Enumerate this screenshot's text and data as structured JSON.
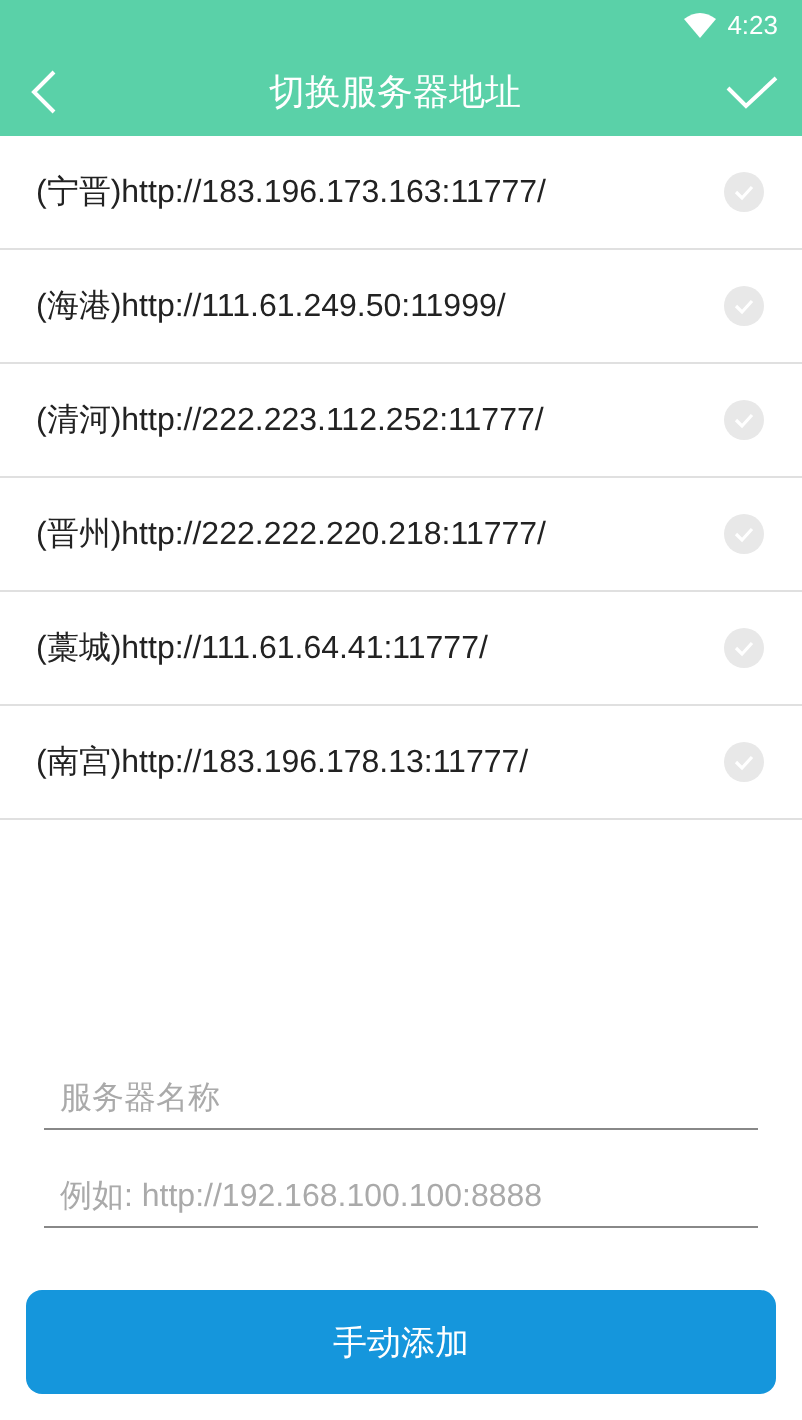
{
  "status_bar": {
    "time": "4:23"
  },
  "app_bar": {
    "title": "切换服务器地址"
  },
  "servers": [
    {
      "label": "(宁晋)http://183.196.173.163:11777/",
      "selected": false
    },
    {
      "label": "(海港)http://111.61.249.50:11999/",
      "selected": false
    },
    {
      "label": "(清河)http://222.223.112.252:11777/",
      "selected": false
    },
    {
      "label": "(晋州)http://222.222.220.218:11777/",
      "selected": false
    },
    {
      "label": "(藁城)http://111.61.64.41:11777/",
      "selected": false
    },
    {
      "label": "(南宫)http://183.196.178.13:11777/",
      "selected": false
    }
  ],
  "form": {
    "name_field": {
      "placeholder": "服务器名称"
    },
    "url_field": {
      "placeholder": "例如: http://192.168.100.100:8888"
    },
    "add_button": "手动添加"
  }
}
